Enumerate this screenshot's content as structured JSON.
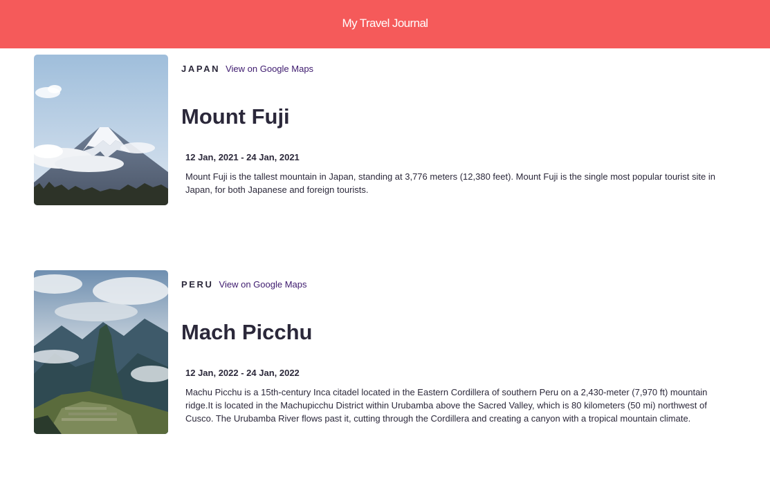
{
  "header": {
    "title": "My Travel Journal"
  },
  "entries": [
    {
      "country": "JAPAN",
      "maps_link": "View on Google Maps",
      "title": "Mount Fuji",
      "dates": "12 Jan, 2021 - 24 Jan, 2021",
      "description": "Mount Fuji is the tallest mountain in Japan, standing at 3,776 meters (12,380 feet). Mount Fuji is the single most popular tourist site in Japan, for both Japanese and foreign tourists."
    },
    {
      "country": "PERU",
      "maps_link": "View on Google Maps",
      "title": "Mach Picchu",
      "dates": "12 Jan, 2022 - 24 Jan, 2022",
      "description": "Machu Picchu is a 15th-century Inca citadel located in the Eastern Cordillera of southern Peru on a 2,430-meter (7,970 ft) mountain ridge.It is located in the Machupicchu District within Urubamba above the Sacred Valley, which is 80 kilometers (50 mi) northwest of Cusco. The Urubamba River flows past it, cutting through the Cordillera and creating a canyon with a tropical mountain climate."
    }
  ],
  "colors": {
    "header_bg": "#f55a5a",
    "link": "#3d1a6e",
    "text": "#2b283a"
  }
}
